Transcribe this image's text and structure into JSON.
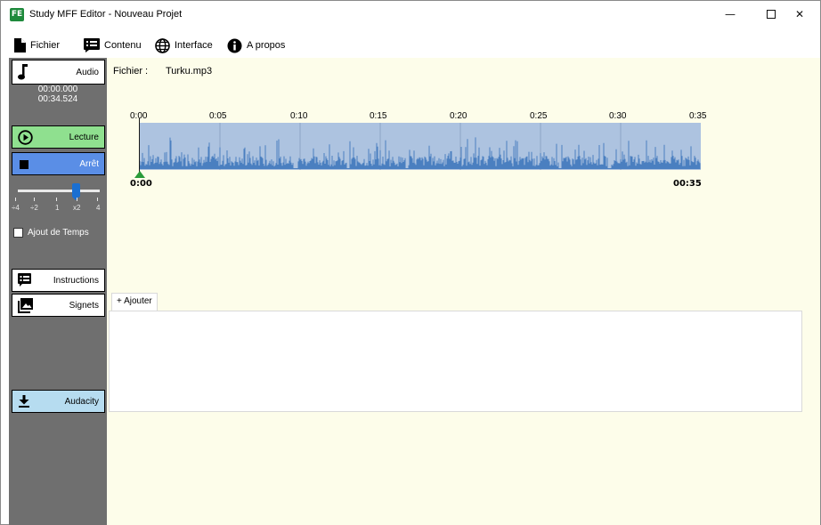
{
  "window": {
    "title": "Study MFF Editor - Nouveau Projet",
    "app_icon_text": "FE",
    "controls": {
      "minimize": "—",
      "close": "✕"
    }
  },
  "menu": {
    "items": [
      {
        "label": "Fichier",
        "icon": "file-icon"
      },
      {
        "label": "Contenu",
        "icon": "list-icon"
      },
      {
        "label": "Interface",
        "icon": "globe-icon"
      },
      {
        "label": "A propos",
        "icon": "info-icon"
      }
    ]
  },
  "sidebar": {
    "audio_label": "Audio",
    "current_time": "00:00.000",
    "total_time": "00:34.524",
    "lecture_label": "Lecture",
    "arret_label": "Arrêt",
    "speed": {
      "labels": [
        "÷4",
        "÷2",
        "1",
        "x2",
        "4"
      ],
      "selected": "x2"
    },
    "ajout_temps_label": "Ajout de Temps",
    "ajout_temps_checked": false,
    "instructions_label": "Instructions",
    "signets_label": "Signets",
    "audacity_label": "Audacity"
  },
  "main": {
    "file_label": "Fichier :",
    "file_name": "Turku.mp3",
    "timeline_labels": [
      "0:00",
      "0:05",
      "0:10",
      "0:15",
      "0:20",
      "0:25",
      "0:30",
      "0:35"
    ],
    "start_time": "0:00",
    "end_time": "00:35",
    "add_tab_label": "+ Ajouter"
  },
  "colors": {
    "sidebar_bg": "#6f6f6f",
    "main_bg": "#fdfdea",
    "lecture_bg": "#8fe08f",
    "arret_bg": "#5a8ee6",
    "audacity_bg": "#b6dcf0",
    "wave_bg": "#adc3e0",
    "wave_fg": "#4a7fc0",
    "cursor": "#2a9b3a"
  }
}
